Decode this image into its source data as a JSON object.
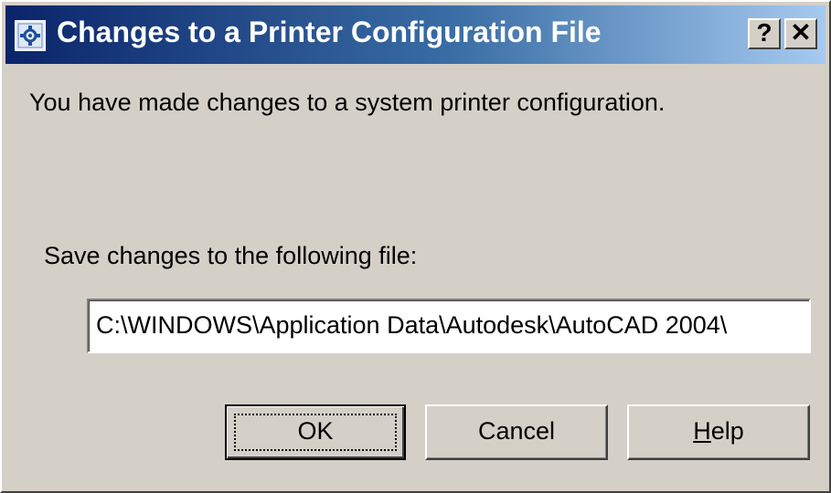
{
  "dialog": {
    "title": "Changes to a Printer Configuration File",
    "help_glyph": "?",
    "close_glyph": "✕",
    "message": "You have made changes to a system printer configuration.",
    "save_label": "Save changes to the following file:",
    "file_path": "C:\\WINDOWS\\Application Data\\Autodesk\\AutoCAD 2004\\"
  },
  "buttons": {
    "ok_label": "OK",
    "cancel_label": "Cancel",
    "help_mnemonic": "H",
    "help_rest": "elp"
  },
  "icons": {
    "title_icon": "printer-config-icon",
    "help": "question-mark-icon",
    "close": "close-icon"
  },
  "colors": {
    "face": "#d4d0c8",
    "title_start": "#0a246a",
    "title_end": "#a6caf0",
    "field_bg": "#ffffff"
  }
}
